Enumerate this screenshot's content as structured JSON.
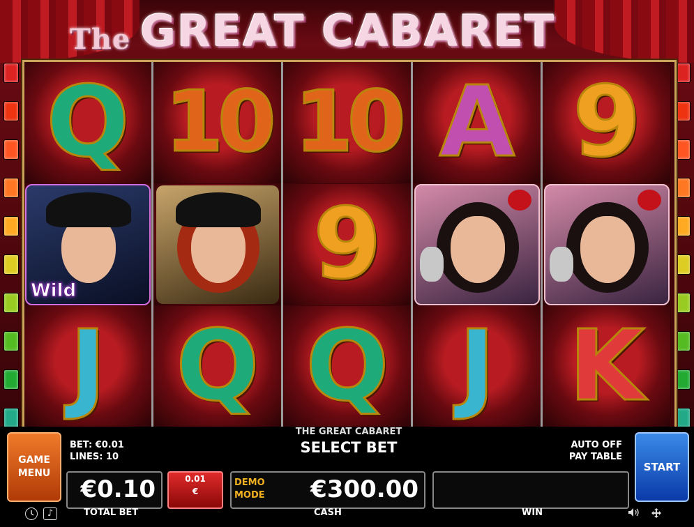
{
  "title": {
    "prefix": "The",
    "main": "GREAT CABARET"
  },
  "colors": {
    "lamps": [
      "#d22",
      "#e31",
      "#f52",
      "#f72",
      "#fa2",
      "#dc2",
      "#9c2",
      "#5b2",
      "#2a3",
      "#2a8",
      "#29a"
    ]
  },
  "reels": [
    [
      {
        "symbol": "Q",
        "kind": "letter",
        "color": "Q"
      },
      {
        "symbol": "man-in-hat",
        "kind": "character",
        "label": "Wild"
      },
      {
        "symbol": "J",
        "kind": "letter",
        "color": "J"
      }
    ],
    [
      {
        "symbol": "10",
        "kind": "letter",
        "color": "10"
      },
      {
        "symbol": "woman-in-hat",
        "kind": "character",
        "label": ""
      },
      {
        "symbol": "Q",
        "kind": "letter",
        "color": "Q"
      }
    ],
    [
      {
        "symbol": "10",
        "kind": "letter",
        "color": "10"
      },
      {
        "symbol": "9",
        "kind": "letter",
        "color": "9"
      },
      {
        "symbol": "Q",
        "kind": "letter",
        "color": "Q"
      }
    ],
    [
      {
        "symbol": "A",
        "kind": "letter",
        "color": "A"
      },
      {
        "symbol": "singer-with-mic",
        "kind": "character",
        "label": ""
      },
      {
        "symbol": "J",
        "kind": "letter",
        "color": "J"
      }
    ],
    [
      {
        "symbol": "9",
        "kind": "letter",
        "color": "9"
      },
      {
        "symbol": "singer-with-mic",
        "kind": "character",
        "label": ""
      },
      {
        "symbol": "K",
        "kind": "letter",
        "color": "K"
      }
    ]
  ],
  "panel": {
    "marquee": "THE GREAT CABARET",
    "status": "SELECT BET",
    "bet_line": "BET: €0.01",
    "lines_line": "LINES: 10",
    "auto_label": "AUTO OFF",
    "paytable_label": "PAY TABLE",
    "game_menu_line1": "GAME",
    "game_menu_line2": "MENU",
    "start_label": "START",
    "total_bet_value": "€0.10",
    "total_bet_caption": "TOTAL BET",
    "coin_value": "0.01",
    "coin_currency": "€",
    "demo_line1": "DEMO",
    "demo_line2": "MODE",
    "cash_value": "€300.00",
    "cash_caption": "CASH",
    "win_value": "",
    "win_caption": "WIN"
  },
  "icons": {
    "clock": "clock-icon",
    "music": "music-note-icon",
    "sound": "speaker-icon",
    "fullscreen": "fullscreen-icon"
  }
}
